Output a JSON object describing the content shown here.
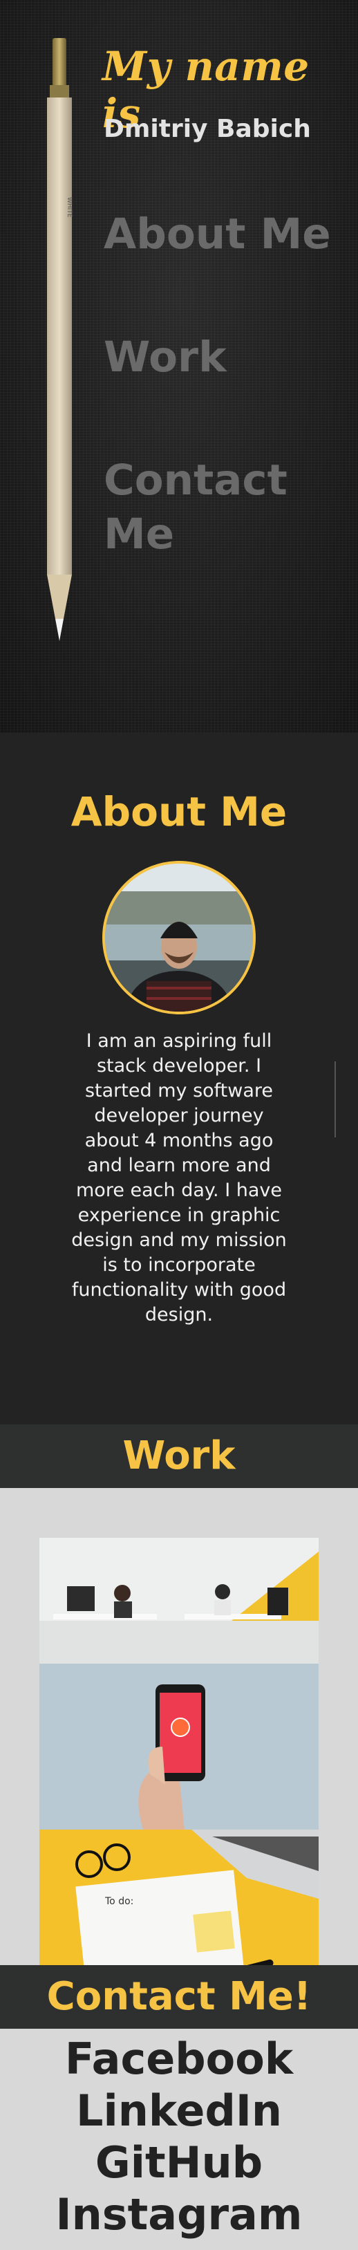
{
  "hero": {
    "title": "My name is",
    "name": "Dmitriy Babich",
    "pencil_label": "WHITE"
  },
  "nav": {
    "about": "About Me",
    "work": "Work",
    "contact_line1": "Contact",
    "contact_line2": "Me"
  },
  "about": {
    "title": "About Me",
    "text": "I am an aspiring full stack developer. I started my software developer journey about 4 months ago and learn more and more each day. I have experience in graphic design and my mission is to incorporate functionality with good design."
  },
  "work": {
    "title": "Work",
    "note_label": "To do:"
  },
  "contact": {
    "title": "Contact Me!",
    "links": [
      "Facebook",
      "LinkedIn",
      "GitHub",
      "Instagram"
    ]
  },
  "colors": {
    "accent": "#f6c344",
    "dark_bg": "#232323",
    "light_bg": "#d8d8d8",
    "nav_gray": "#6a6a6a"
  }
}
